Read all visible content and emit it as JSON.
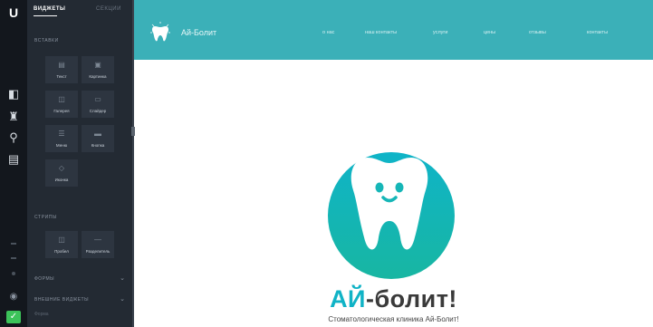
{
  "rail": {
    "logo": "U",
    "icons": [
      "pages-icon",
      "shop-icon",
      "lightbulb-icon",
      "chat-icon"
    ],
    "bottom_icons": [
      "minus-icon",
      "minus-icon",
      "dot-icon",
      "eye-icon",
      "check-icon"
    ]
  },
  "panel": {
    "tabs": [
      "ВИДЖЕТЫ",
      "СЕКЦИИ"
    ],
    "basic_section": "ВСТАВКИ",
    "basic_widgets": [
      {
        "label": "Текст",
        "icon": "text-icon"
      },
      {
        "label": "Картинка",
        "icon": "image-icon"
      },
      {
        "label": "Галерея",
        "icon": "gallery-icon"
      },
      {
        "label": "Слайдер",
        "icon": "slider-icon"
      },
      {
        "label": "Меню",
        "icon": "menu-icon"
      },
      {
        "label": "Кнопка",
        "icon": "button-icon"
      },
      {
        "label": "Иконка",
        "icon": "star-icon"
      }
    ],
    "strips_section": "СТРИПЫ",
    "strip_widgets": [
      {
        "label": "Пробел",
        "icon": "space-icon"
      },
      {
        "label": "Разделитель",
        "icon": "divider-icon"
      }
    ],
    "collapsed_sections": [
      "ФОРМЫ",
      "ВНЕШНИЕ ВИДЖЕТЫ"
    ],
    "subitem": "Форма"
  },
  "site": {
    "name": "Ай-Болит",
    "nav": [
      "о нас",
      "наш контакты",
      "услуги",
      "цены",
      "отзывы",
      "контакты"
    ],
    "colors": {
      "header": "#3bb0b8",
      "accent": "#10b3c6"
    }
  },
  "hero": {
    "title_part1": "АЙ",
    "title_part2": "-болит!",
    "subtitle": "Стоматологическая клиника Ай-Болит!"
  }
}
